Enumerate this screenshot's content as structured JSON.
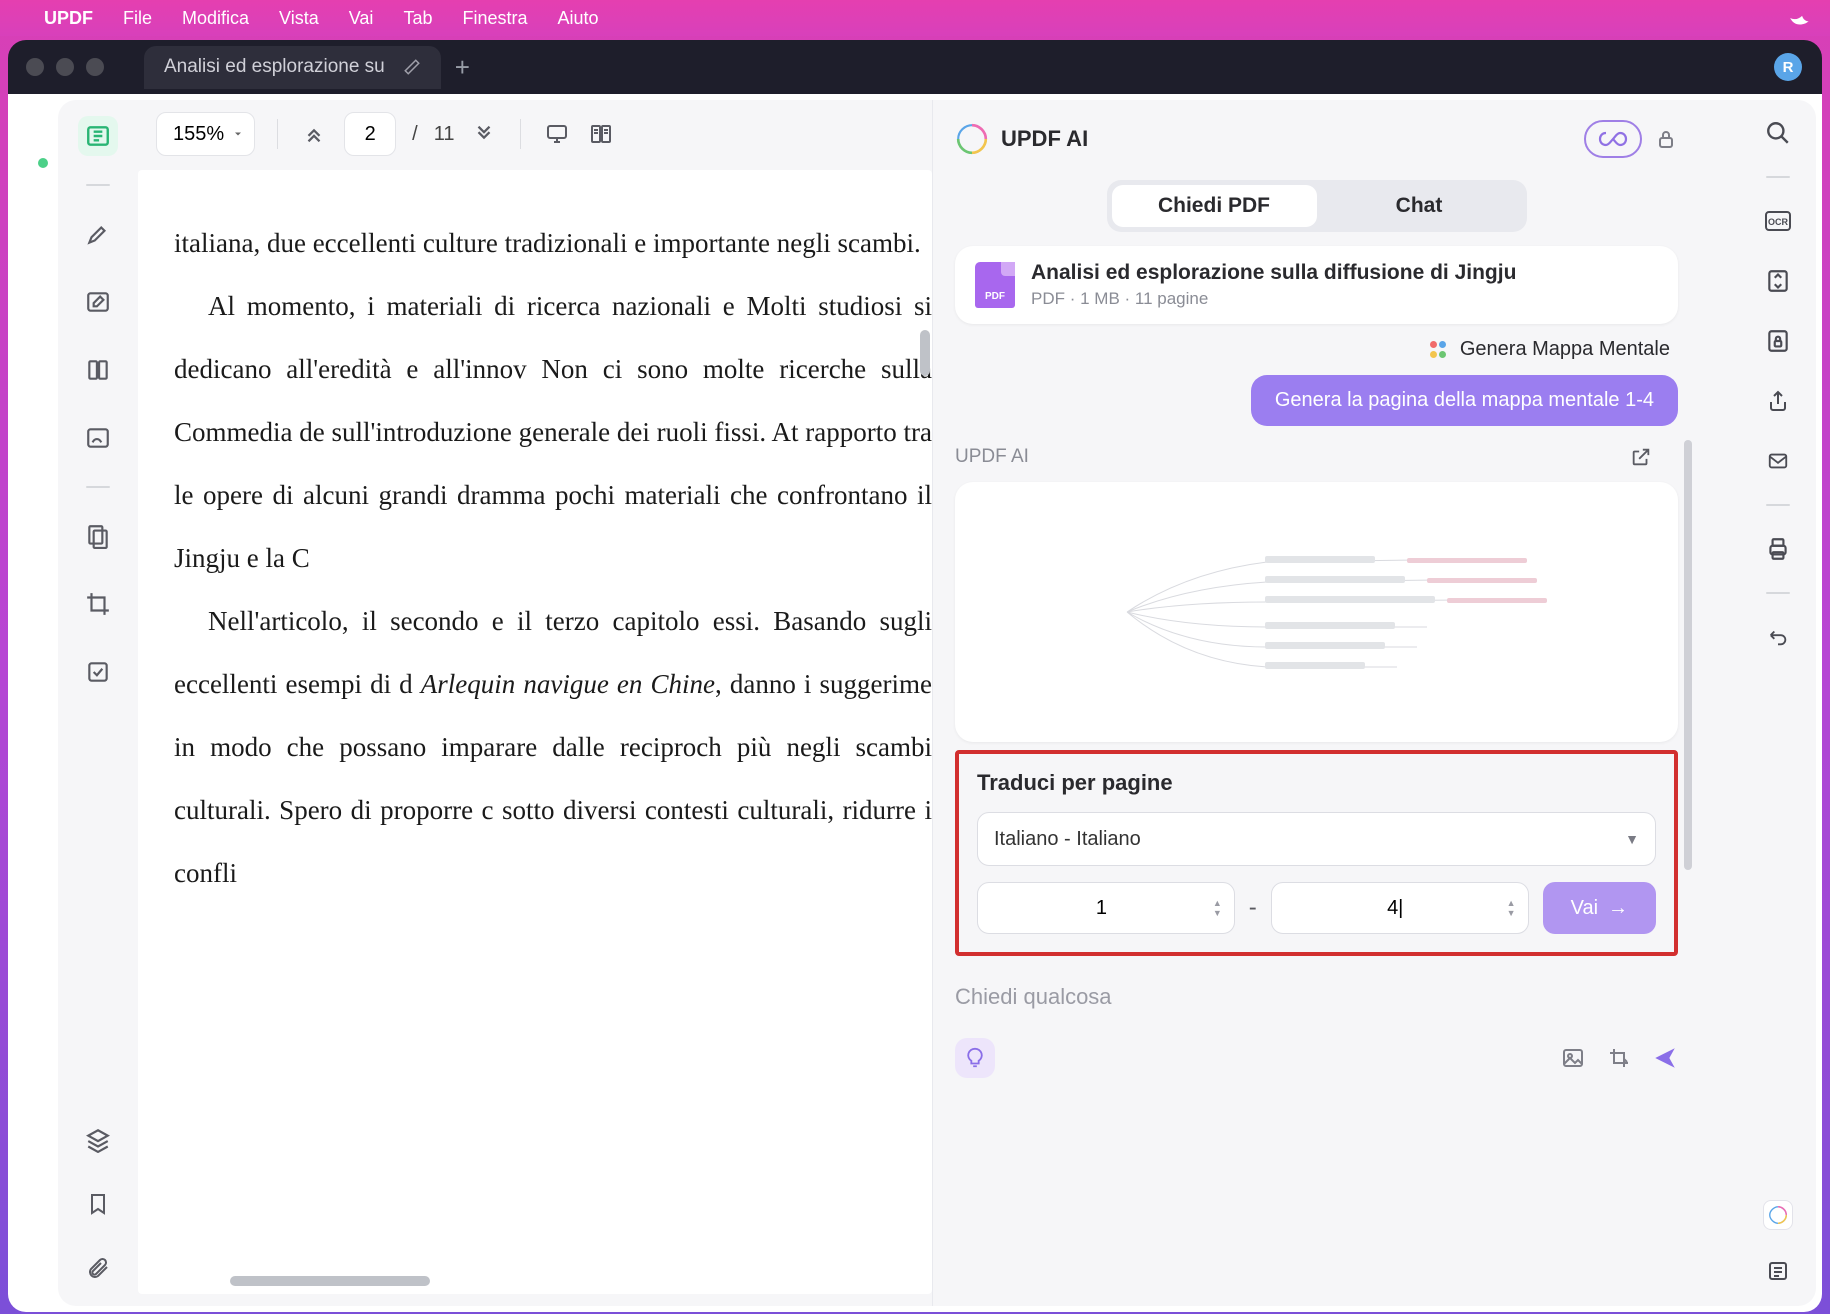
{
  "menubar": {
    "app_name": "UPDF",
    "items": [
      "File",
      "Modifica",
      "Vista",
      "Vai",
      "Tab",
      "Finestra",
      "Aiuto"
    ]
  },
  "tab": {
    "title": "Analisi ed esplorazione su"
  },
  "avatar_initial": "R",
  "toolbar": {
    "zoom": "155%",
    "page_current": "2",
    "page_total": "11",
    "slash": "/"
  },
  "document": {
    "p1": "italiana, due eccellenti culture tradizionali e importante negli scambi.",
    "p2_a": "Al momento, i materiali di ricerca nazionali e Molti studiosi si dedicano all'eredità e all'innov Non ci sono molte ricerche sulla Commedia de sull'introduzione generale dei ruoli fissi. At rapporto tra le opere di alcuni grandi dramma pochi materiali che confrontano il Jingju e la C",
    "p3_a": "Nell'articolo, il secondo e il terzo capitolo essi. Basando sugli eccellenti esempi di d ",
    "p3_em": "Arlequin navigue en Chine",
    "p3_b": ", danno i suggerime in modo che possano imparare dalle reciproch più negli scambi culturali. Spero di proporre c sotto diversi contesti culturali, ridurre i confli"
  },
  "ai": {
    "title": "UPDF AI",
    "tab_ask": "Chiedi PDF",
    "tab_chat": "Chat",
    "file_title": "Analisi ed esplorazione sulla diffusione di Jingju",
    "file_type": "PDF",
    "file_size": "1 MB",
    "file_pages": "11 pagine",
    "mindmap_label": "Genera Mappa Mentale",
    "mindmap_btn": "Genera la pagina della mappa mentale 1-4",
    "sub_header": "UPDF AI",
    "translate_title": "Traduci per pagine",
    "language_value": "Italiano - Italiano",
    "range_from": "1",
    "range_to": "4",
    "range_to_display": "4|",
    "go_label": "Vai",
    "go_arrow": "→",
    "chat_placeholder": "Chiedi qualcosa"
  }
}
